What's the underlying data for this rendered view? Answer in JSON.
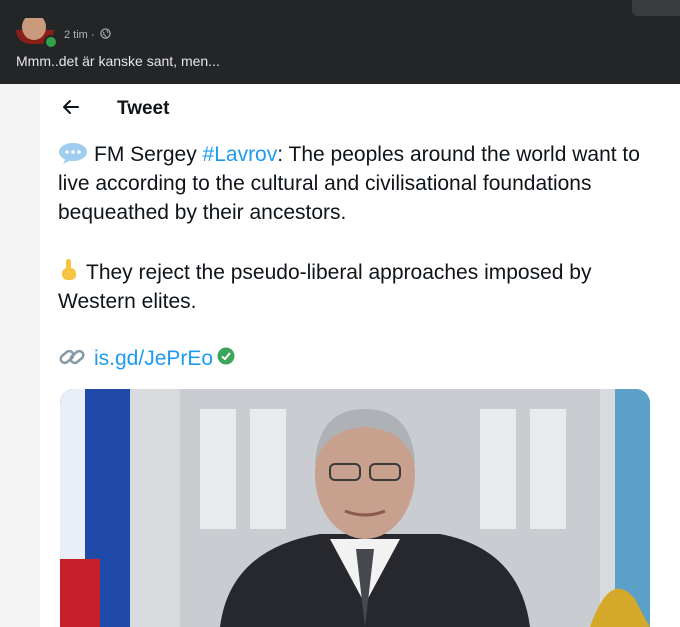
{
  "post": {
    "time": "2 tim",
    "separator": "·",
    "text": "Mmm..det är kanske sant, men..."
  },
  "tweet": {
    "back_icon": "arrow-left-icon",
    "title": "Tweet",
    "para1_prefix": "FM Sergey ",
    "hashtag": "#Lavrov",
    "para1_rest": ": The peoples around the world want to live according to the cultural and civilisational foundations bequeathed by their ancestors.",
    "para2": "They reject the pseudo-liberal approaches imposed by Western elites.",
    "link": "is.gd/JePrEo"
  },
  "colors": {
    "facebook_bg": "#242526",
    "twitter_blue": "#1d9bf0",
    "verified_green": "#3ba55c"
  }
}
